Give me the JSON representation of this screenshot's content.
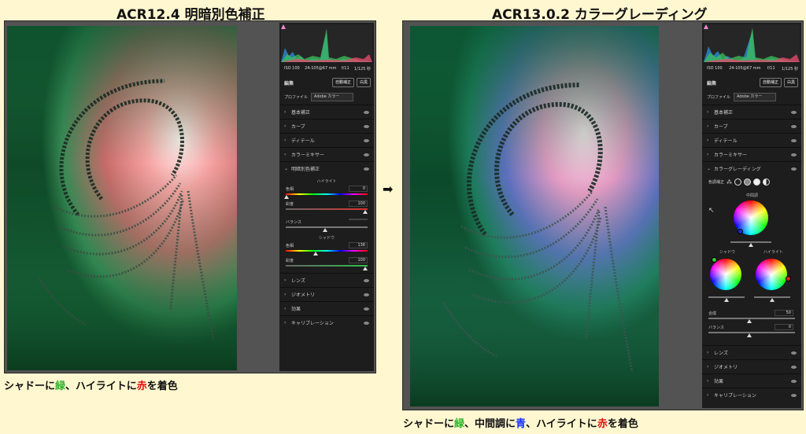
{
  "left": {
    "title": "ACR12.4 明暗別色補正",
    "caption": {
      "pre": "シャドーに",
      "green": "緑",
      "mid": "、ハイライトに",
      "red": "赤",
      "post": "を着色"
    },
    "panel": {
      "meta": [
        "ISO 100",
        "24-105@67 mm",
        "f/11",
        "1/125 秒"
      ],
      "edit_title": "編集",
      "auto_button": "自動補正",
      "bw_button": "白黒",
      "profile_label": "プロファイル",
      "profile_value": "Adobe カラー",
      "sections_top": [
        "基本補正",
        "カーブ",
        "ディテール",
        "カラーミキサー"
      ],
      "split_section": "明暗別色補正",
      "highlight_title": "ハイライト",
      "hue_label": "色相",
      "sat_label": "彩度",
      "balance_label": "バランス",
      "shadow_title": "シャドウ",
      "values": {
        "highlight_hue": "0",
        "highlight_sat": "100",
        "balance": "",
        "shadow_hue": "136",
        "shadow_sat": "100"
      },
      "sections_bottom": [
        "レンズ",
        "ジオメトリ",
        "効果",
        "キャリブレーション"
      ]
    }
  },
  "right": {
    "title": "ACR13.0.2 カラーグレーディング",
    "caption": {
      "pre": "シャドーに",
      "green": "緑",
      "mid1": "、中間調に",
      "blue": "青",
      "mid2": "、ハイライトに",
      "red": "赤",
      "post": "を着色"
    },
    "panel": {
      "meta": [
        "ISO 100",
        "24-105@67 mm",
        "f/11",
        "1/125 秒"
      ],
      "edit_title": "編集",
      "auto_button": "自動補正",
      "bw_button": "白黒",
      "profile_label": "プロファイル",
      "profile_value": "Adobe カラー",
      "sections_top": [
        "基本補正",
        "カーブ",
        "ディテール",
        "カラーミキサー"
      ],
      "grading_section": "カラーグレーディング",
      "mode_label": "色調補正",
      "midtone_label": "中間調",
      "shadow_label": "シャドウ",
      "highlight_label": "ハイライト",
      "blend_label": "合成",
      "blend_value": "50",
      "balance_label": "バランス",
      "balance_value": "0",
      "sections_bottom": [
        "レンズ",
        "ジオメトリ",
        "効果",
        "キャリブレーション"
      ]
    }
  },
  "arrow": "➡",
  "colors": {
    "caption_green": "#2bb52b",
    "caption_red": "#e01010",
    "caption_blue": "#1430ff",
    "panel_bg": "#1d1d1d"
  }
}
